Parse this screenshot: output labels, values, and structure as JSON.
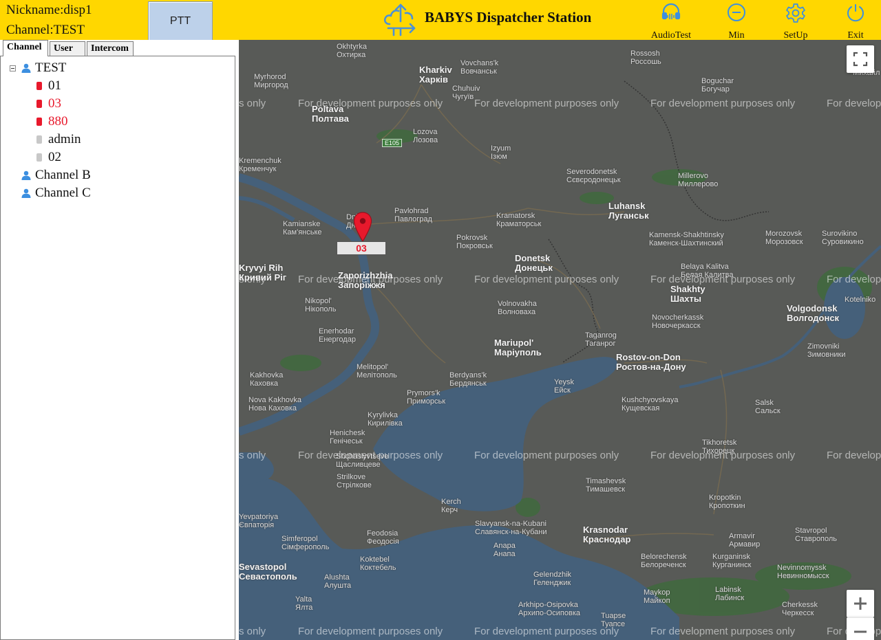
{
  "header": {
    "nickname": "Nickname:disp1",
    "channel": "Channel:TEST",
    "ptt_label": "PTT",
    "app_title": "BABYS Dispatcher Station",
    "tools": {
      "audio_test": "AudioTest",
      "min": "Min",
      "setup": "SetUp",
      "exit": "Exit"
    },
    "accent_color": "#FFD700"
  },
  "tabs": [
    {
      "label": "Channel",
      "active": true
    },
    {
      "label": "User",
      "active": false
    },
    {
      "label": "Intercom",
      "active": false
    }
  ],
  "tree": {
    "groups": [
      {
        "label": "TEST",
        "icon": "group-user-icon",
        "expanded": true
      },
      {
        "label": "Channel B",
        "icon": "group-user-icon",
        "expanded": false
      },
      {
        "label": "Channel C",
        "icon": "group-user-icon",
        "expanded": false
      }
    ],
    "members": [
      {
        "label": "01",
        "status": "online",
        "text_color": "#111111"
      },
      {
        "label": "03",
        "status": "online",
        "text_color": "#E8192C"
      },
      {
        "label": "880",
        "status": "online",
        "text_color": "#E8192C"
      },
      {
        "label": "admin",
        "status": "offline",
        "text_color": "#111111"
      },
      {
        "label": "02",
        "status": "offline",
        "text_color": "#111111"
      }
    ],
    "online_color": "#E8192C",
    "offline_color": "#C8C8C8"
  },
  "map": {
    "watermark": "For development purposes only",
    "highway": "E105",
    "marker_label": "03",
    "cities": [
      {
        "en": "Kharkiv",
        "local": "Харків"
      },
      {
        "en": "Poltava",
        "local": "Полтава"
      },
      {
        "en": "Kremenchuk",
        "local": "Кременчук"
      },
      {
        "en": "Myrhorod",
        "local": "Миргород"
      },
      {
        "en": "Okhtyrka",
        "local": "Охтирка"
      },
      {
        "en": "Vovchans'k",
        "local": "Вовчанськ"
      },
      {
        "en": "Chuhuiv",
        "local": "Чугуїв"
      },
      {
        "en": "Rossosh",
        "local": "Россошь"
      },
      {
        "en": "Boguchar",
        "local": "Богучар"
      },
      {
        "en": "Izyum",
        "local": "Ізюм"
      },
      {
        "en": "Lozova",
        "local": "Лозова"
      },
      {
        "en": "Severodonetsk",
        "local": "Сєвєродонецьк"
      },
      {
        "en": "Millerovo",
        "local": "Миллерово"
      },
      {
        "en": "Luhansk",
        "local": "Луганськ"
      },
      {
        "en": "Pavlohrad",
        "local": "Павлоград"
      },
      {
        "en": "Kamianske",
        "local": "Кам'янське"
      },
      {
        "en": "Dnipro",
        "local": "Дніпро"
      },
      {
        "en": "Kramatorsk",
        "local": "Краматорськ"
      },
      {
        "en": "Pokrovsk",
        "local": "Покровськ"
      },
      {
        "en": "Donetsk",
        "local": "Донецьк"
      },
      {
        "en": "Kamensk-Shakhtinsky",
        "local": "Каменск-Шахтинский"
      },
      {
        "en": "Morozovsk",
        "local": "Морозовск"
      },
      {
        "en": "Surovikino",
        "local": "Суровикино"
      },
      {
        "en": "Kryvyi Rih",
        "local": "Кривий Ріг"
      },
      {
        "en": "Zaporizhzhia",
        "local": "Запоріжжя"
      },
      {
        "en": "Nikopol'",
        "local": "Нікополь"
      },
      {
        "en": "Enerhodar",
        "local": "Енергодар"
      },
      {
        "en": "Belaya Kalitva",
        "local": "Белая Калитва"
      },
      {
        "en": "Shakhty",
        "local": "Шахты"
      },
      {
        "en": "Volnovakha",
        "local": "Волноваха"
      },
      {
        "en": "Novocherkassk",
        "local": "Новочеркасск"
      },
      {
        "en": "Volgodonsk",
        "local": "Волгодонск"
      },
      {
        "en": "Kotelniko",
        "local": ""
      },
      {
        "en": "Mariupol'",
        "local": "Маріуполь"
      },
      {
        "en": "Taganrog",
        "local": "Таганрог"
      },
      {
        "en": "Rostov-on-Don",
        "local": "Ростов-на-Дону"
      },
      {
        "en": "Zimovniki",
        "local": "Зимовники"
      },
      {
        "en": "Melitopol'",
        "local": "Мелітополь"
      },
      {
        "en": "Berdyans'k",
        "local": "Бердянськ"
      },
      {
        "en": "Kakhovka",
        "local": "Каховка"
      },
      {
        "en": "Nova Kakhovka",
        "local": "Нова Каховка"
      },
      {
        "en": "Prymors'k",
        "local": "Приморськ"
      },
      {
        "en": "Yeysk",
        "local": "Ейск"
      },
      {
        "en": "Kushchyovskaya",
        "local": "Кущевская"
      },
      {
        "en": "Salsk",
        "local": "Сальск"
      },
      {
        "en": "Kyrylivka",
        "local": "Кирилівка"
      },
      {
        "en": "Henichesk",
        "local": "Генічеськ"
      },
      {
        "en": "Shchaslyvtseve",
        "local": "Щасливцеве"
      },
      {
        "en": "Strilkove",
        "local": "Стрілкове"
      },
      {
        "en": "Tikhoretsk",
        "local": "Тихорецк"
      },
      {
        "en": "Timashevsk",
        "local": "Тимашевск"
      },
      {
        "en": "Kropotkin",
        "local": "Кропоткин"
      },
      {
        "en": "Yevpatoriya",
        "local": "Євпаторія"
      },
      {
        "en": "Kerch",
        "local": "Керч"
      },
      {
        "en": "Slavyansk-na-Kubani",
        "local": "Славянск-на-Кубани"
      },
      {
        "en": "Krasnodar",
        "local": "Краснодар"
      },
      {
        "en": "Armavir",
        "local": "Армавир"
      },
      {
        "en": "Stavropol",
        "local": "Ставрополь"
      },
      {
        "en": "Simferopol",
        "local": "Сімферополь"
      },
      {
        "en": "Feodosia",
        "local": "Феодосія"
      },
      {
        "en": "Anapa",
        "local": "Анапа"
      },
      {
        "en": "Belorechensk",
        "local": "Белореченск"
      },
      {
        "en": "Kurganinsk",
        "local": "Курганинск"
      },
      {
        "en": "Nevinnomyssk",
        "local": "Невинномысск"
      },
      {
        "en": "Koktebel",
        "local": "Коктебель"
      },
      {
        "en": "Sevastopol",
        "local": "Севастополь"
      },
      {
        "en": "Alushta",
        "local": "Алушта"
      },
      {
        "en": "Gelendzhik",
        "local": "Геленджик"
      },
      {
        "en": "Maykop",
        "local": "Майкоп"
      },
      {
        "en": "Labinsk",
        "local": "Лабинск"
      },
      {
        "en": "Cherkessk",
        "local": "Черкесск"
      },
      {
        "en": "Yalta",
        "local": "Ялта"
      },
      {
        "en": "Arkhipo-Osipovka",
        "local": "Архипо-Осиповка"
      },
      {
        "en": "Tuapse",
        "local": "Туапсе"
      },
      {
        "en": "Mykhailivka",
        "local": "Михайл"
      }
    ]
  }
}
